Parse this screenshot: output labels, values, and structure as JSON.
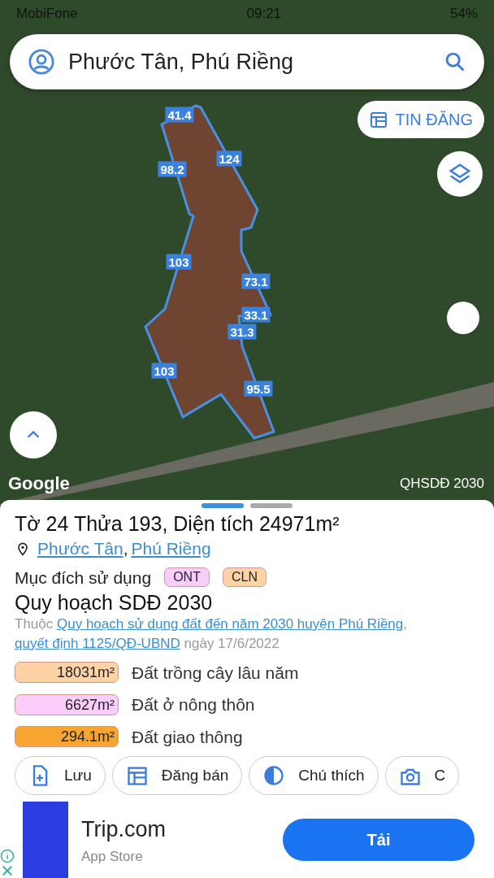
{
  "status_bar": {
    "carrier": "MobiFone",
    "time": "09:21",
    "battery": "54%"
  },
  "search": {
    "value": "Phước Tân, Phú Riềng"
  },
  "map": {
    "listing_button": "TIN ĐĂNG",
    "attribution": "Google",
    "layer_label": "QHSDĐ 2030",
    "edge_labels": [
      {
        "text": "41.4"
      },
      {
        "text": "124"
      },
      {
        "text": "98.2"
      },
      {
        "text": "103"
      },
      {
        "text": "73.1"
      },
      {
        "text": "33.1"
      },
      {
        "text": "31.3"
      },
      {
        "text": "103"
      },
      {
        "text": "95.5"
      }
    ]
  },
  "sheet": {
    "pager": [
      {
        "selected": true
      },
      {
        "selected": false
      }
    ],
    "title": "Tờ 24 Thửa 193, Diện tích 24971m²",
    "location": [
      "Phước Tân",
      "Phú Riềng"
    ],
    "location_separator": ",",
    "purpose_label": "Mục đích sử dụng",
    "purpose_tags": [
      {
        "text": "ONT",
        "color": "#f9ccf9"
      },
      {
        "text": "CLN",
        "color": "#fdd3a6"
      }
    ],
    "plan_title": "Quy hoạch SDĐ 2030",
    "plan_source": {
      "prefix": "Thuộc",
      "link_1": "Quy hoạch sử dụng đất đến năm 2030 huyện Phú Riềng",
      "separator": ",",
      "link_2": "quyết định 1125/QĐ-UBND",
      "suffix": "ngày 17/6/2022"
    },
    "areas": [
      {
        "area": "18031m²",
        "name": "Đất trồng cây lâu năm",
        "color": "#fdd3a6"
      },
      {
        "area": "6627m²",
        "name": "Đất ở nông thôn",
        "color": "#f9ccf9"
      },
      {
        "area": "294.1m²",
        "name": "Đất giao thông",
        "color": "#f8a431"
      }
    ],
    "actions": [
      {
        "label": "Lưu",
        "kind": "save"
      },
      {
        "label": "Đăng bán",
        "kind": "listing"
      },
      {
        "label": "Chú thích",
        "kind": "legend"
      },
      {
        "label": "C",
        "kind": "photo"
      }
    ]
  },
  "ad": {
    "title": "Trip.com",
    "subtitle": "App Store",
    "button": "Tải"
  }
}
